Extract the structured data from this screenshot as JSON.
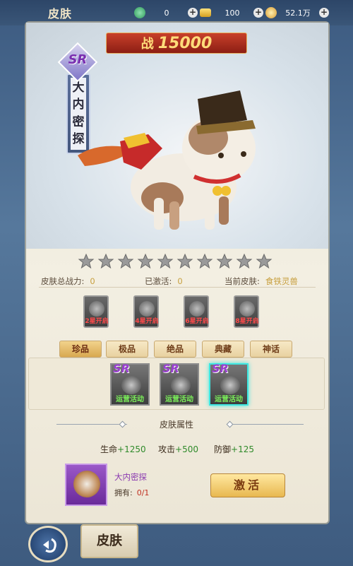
{
  "header": {
    "title": "皮肤",
    "currency": [
      {
        "icon": "jade-icon",
        "value": "0",
        "color": "#3fb06a"
      },
      {
        "icon": "gold-ingot-icon",
        "value": "100",
        "color": "#f0c030"
      },
      {
        "icon": "coin-icon",
        "value": "52.1万",
        "color": "#f0b040"
      }
    ]
  },
  "showcase": {
    "power_label": "战",
    "power_value": "15000",
    "rarity": "SR",
    "skin_name_chars": [
      "大",
      "内",
      "密",
      "探"
    ],
    "stars_total": 10,
    "stars_filled": 0
  },
  "summary": {
    "total_power_label": "皮肤总战力:",
    "total_power_value": "0",
    "activated_label": "已激活:",
    "activated_value": "0",
    "current_label": "当前皮肤:",
    "current_value": "食铁灵兽"
  },
  "star_slots": [
    {
      "label": "2星开启"
    },
    {
      "label": "4星开启"
    },
    {
      "label": "6星开启"
    },
    {
      "label": "8星开启"
    }
  ],
  "tabs": [
    {
      "label": "珍品",
      "active": true
    },
    {
      "label": "极品",
      "active": false
    },
    {
      "label": "绝品",
      "active": false
    },
    {
      "label": "典藏",
      "active": false
    },
    {
      "label": "神话",
      "active": false
    }
  ],
  "skins": [
    {
      "rarity": "SR",
      "source": "运营活动",
      "selected": false
    },
    {
      "rarity": "SR",
      "source": "运营活动",
      "selected": false
    },
    {
      "rarity": "SR",
      "source": "运营活动",
      "selected": true
    }
  ],
  "attributes": {
    "title": "皮肤属性",
    "items": [
      {
        "label": "生命",
        "value": "+1250"
      },
      {
        "label": "攻击",
        "value": "+500"
      },
      {
        "label": "防御",
        "value": "+125"
      }
    ]
  },
  "owner": {
    "name": "大内密探",
    "have_label": "拥有:",
    "have_value": "0/1",
    "activate_label": "激活"
  },
  "bottom_nav": {
    "tab_label": "皮肤"
  }
}
